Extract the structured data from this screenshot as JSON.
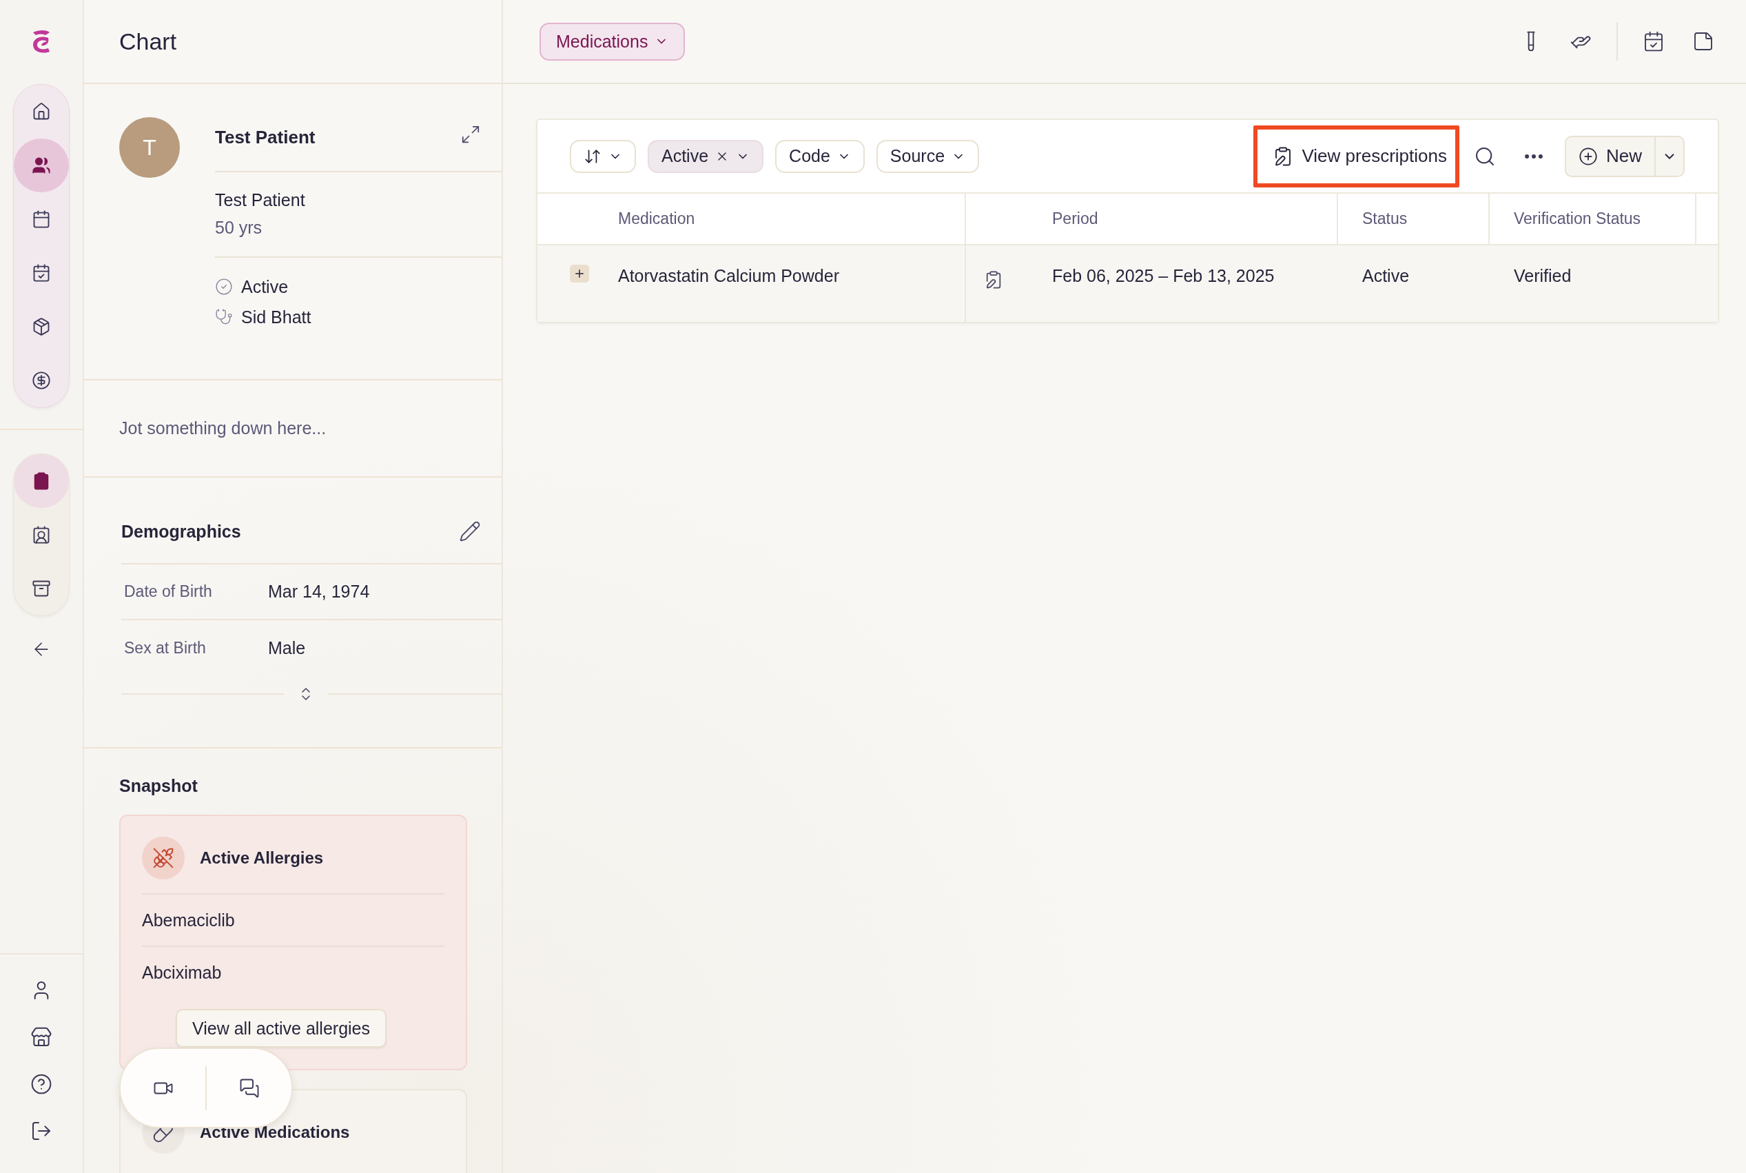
{
  "sidebar": {
    "primary_nav": [
      {
        "selected": false
      },
      {
        "selected": true
      },
      {
        "selected": false
      },
      {
        "selected": false
      },
      {
        "selected": false
      },
      {
        "selected": false
      }
    ],
    "secondary_nav": [
      {
        "selected": true
      },
      {
        "selected": false
      },
      {
        "selected": false
      }
    ]
  },
  "panel": {
    "title": "Chart",
    "patient": {
      "avatar": "T",
      "name": "Test Patient",
      "full_name": "Test Patient",
      "age": "50 yrs",
      "status": "Active",
      "provider": "Sid Bhatt"
    },
    "note": {
      "placeholder": "Jot something down here..."
    },
    "demographics": {
      "title": "Demographics",
      "fields": [
        {
          "label": "Date of Birth",
          "value": "Mar 14, 1974"
        },
        {
          "label": "Sex at Birth",
          "value": "Male"
        }
      ]
    },
    "snapshot": {
      "title": "Snapshot",
      "cards": [
        {
          "kind": "allergies",
          "title": "Active Allergies",
          "items": [
            "Abemaciclib",
            "Abciximab"
          ],
          "action": "View all active allergies"
        },
        {
          "kind": "medications",
          "title": "Active Medications"
        }
      ]
    }
  },
  "main": {
    "section_menu": "Medications",
    "toolbar": {
      "filters": [
        {
          "kind": "sort"
        },
        {
          "kind": "chip",
          "label": "Active",
          "applied": true
        },
        {
          "kind": "chip",
          "label": "Code",
          "applied": false
        },
        {
          "kind": "chip",
          "label": "Source",
          "applied": false
        }
      ],
      "view_prescriptions": {
        "label": "View prescriptions",
        "highlighted": true
      },
      "new_button": "New"
    },
    "table": {
      "columns": [
        "Medication",
        "Period",
        "Status",
        "Verification Status"
      ],
      "rows": [
        {
          "expanded": false,
          "medication": "Atorvastatin Calcium Powder",
          "period": "Feb 06, 2025 – Feb 13, 2025",
          "status": "Active",
          "verification": "Verified"
        }
      ]
    }
  }
}
